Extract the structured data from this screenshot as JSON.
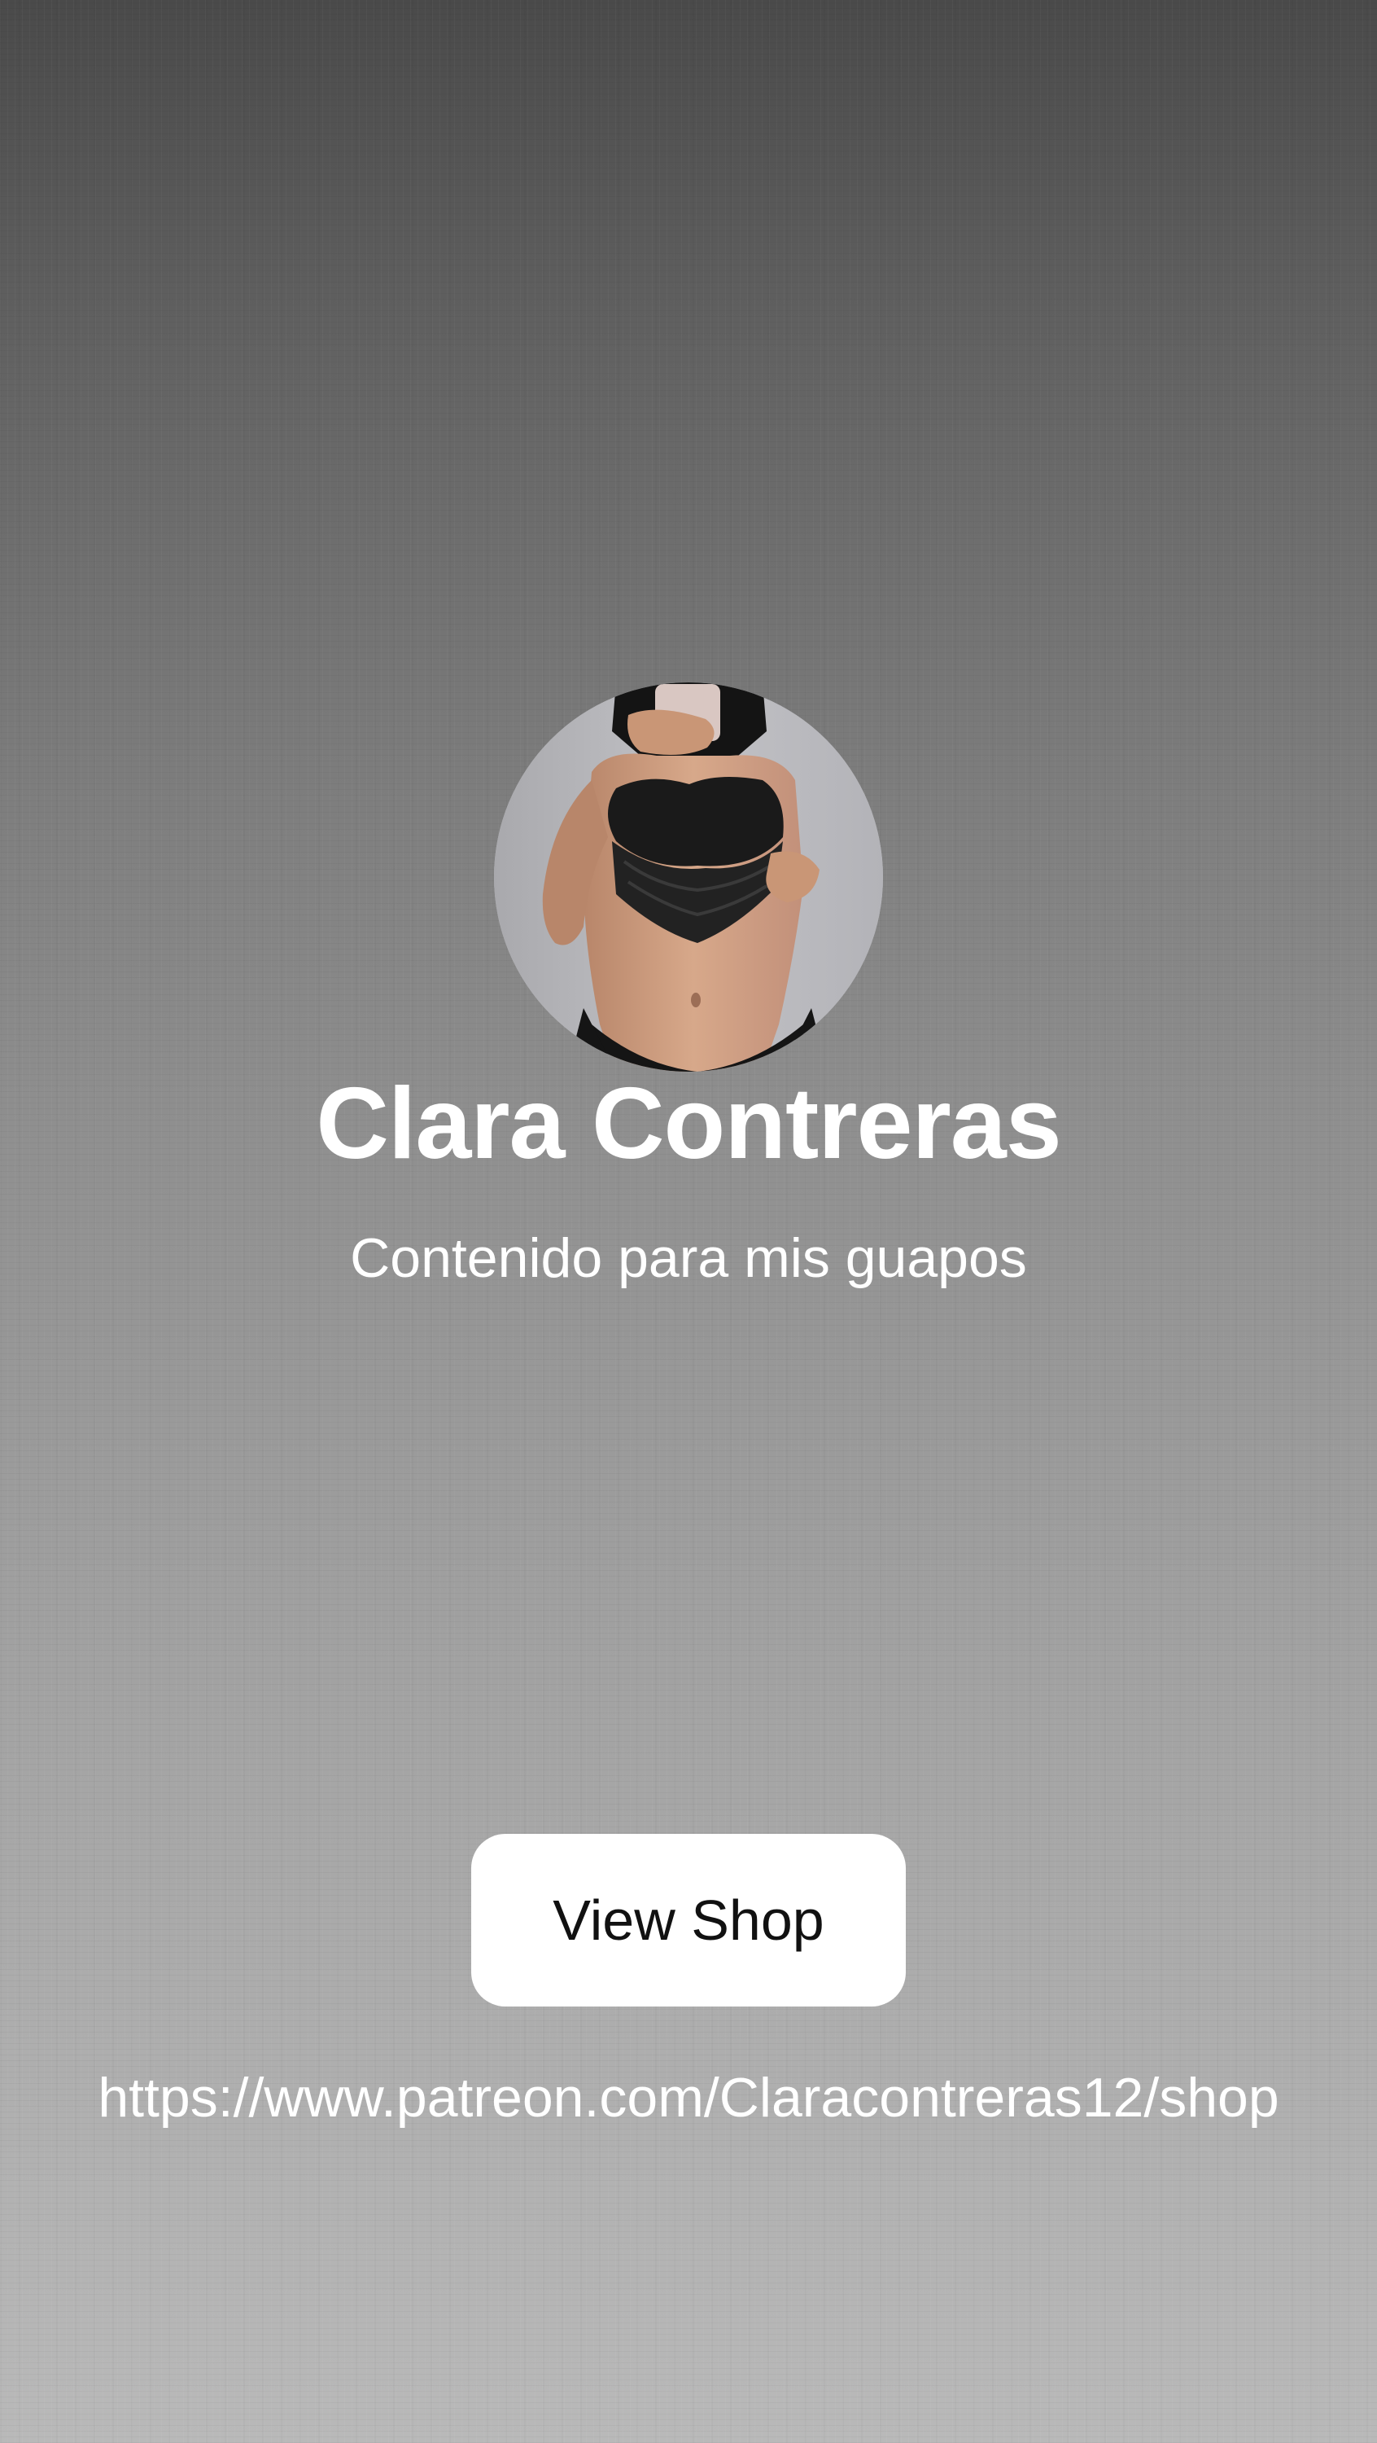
{
  "profile": {
    "avatar_icon": "profile-photo",
    "name": "Clara Contreras",
    "bio": "Contenido para mis guapos"
  },
  "shop": {
    "button_label": "View Shop",
    "link_text": "https://www.patreon.com/Claracontreras12/shop"
  },
  "colors": {
    "background_top": "#4a4a4a",
    "background_bottom": "#b9b9b9",
    "text": "#ffffff",
    "button_background": "#ffffff",
    "button_text": "#111111"
  }
}
